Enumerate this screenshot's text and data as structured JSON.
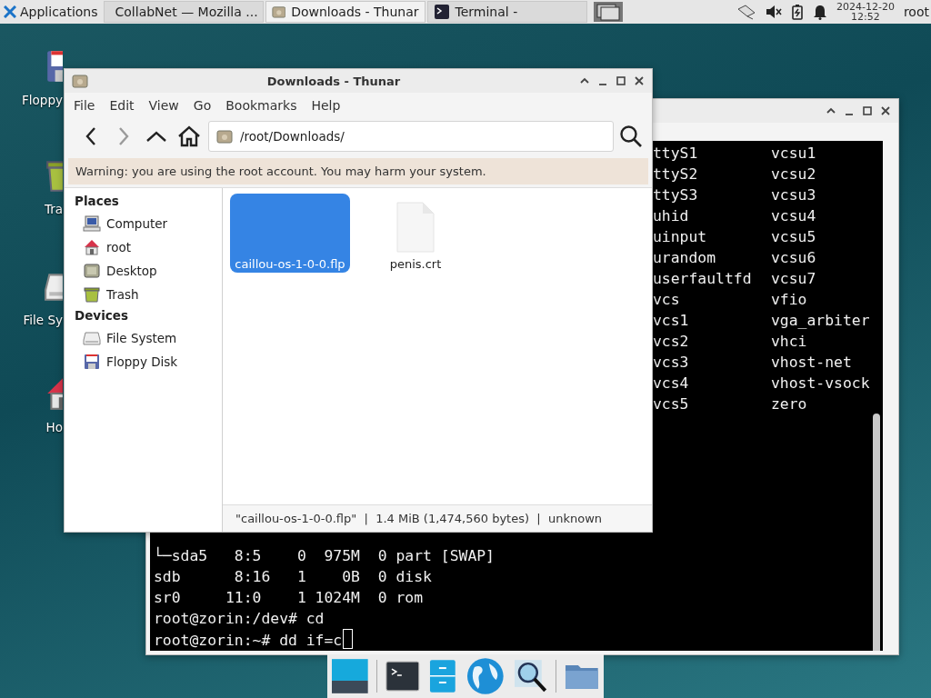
{
  "panel": {
    "app_menu": "Applications",
    "tasks": [
      {
        "label": "CollabNet — Mozilla ...",
        "kind": "browser",
        "selected": false
      },
      {
        "label": "Downloads - Thunar",
        "kind": "folder",
        "selected": true
      },
      {
        "label": "Terminal -",
        "kind": "terminal",
        "selected": false
      }
    ],
    "clock": {
      "date": "2024-12-20",
      "time": "12:52"
    },
    "user": "root"
  },
  "desktop_icons": [
    {
      "label": "Floppy",
      "kind": "floppy"
    },
    {
      "label": "Tra",
      "kind": "trash"
    },
    {
      "label": "File Sy",
      "kind": "drive"
    },
    {
      "label": "Ho",
      "kind": "home"
    }
  ],
  "terminal": {
    "listing": [
      [
        "ttyS1",
        "vcsu1"
      ],
      [
        "ttyS2",
        "vcsu2"
      ],
      [
        "ttyS3",
        "vcsu3"
      ],
      [
        "uhid",
        "vcsu4"
      ],
      [
        "uinput",
        "vcsu5"
      ],
      [
        "urandom",
        "vcsu6"
      ],
      [
        "userfaultfd",
        "vcsu7"
      ],
      [
        "vcs",
        "vfio"
      ],
      [
        "vcs1",
        "vga_arbiter"
      ],
      [
        "vcs2",
        "vhci"
      ],
      [
        "vcs3",
        "vhost-net"
      ],
      [
        "vcs4",
        "vhost-vsock"
      ],
      [
        "vcs5",
        "zero"
      ]
    ],
    "lines": [
      "└─sda5   8:5    0  975M  0 part [SWAP]",
      "sdb      8:16   1    0B  0 disk",
      "sr0     11:0    1 1024M  0 rom",
      "root@zorin:/dev# cd"
    ],
    "prompt": "root@zorin:~# dd if=c"
  },
  "thunar": {
    "title": "Downloads - Thunar",
    "menu": [
      "File",
      "Edit",
      "View",
      "Go",
      "Bookmarks",
      "Help"
    ],
    "toolbar": [
      {
        "kind": "back",
        "disabled": false
      },
      {
        "kind": "forward",
        "disabled": true
      },
      {
        "kind": "up",
        "disabled": false
      },
      {
        "kind": "home",
        "disabled": false
      }
    ],
    "path": "/root/Downloads/",
    "warning": "Warning: you are using the root account. You may harm your system.",
    "sidebar": [
      {
        "heading": "Places",
        "items": [
          {
            "label": "Computer",
            "kind": "computer"
          },
          {
            "label": "root",
            "kind": "home"
          },
          {
            "label": "Desktop",
            "kind": "desktop"
          },
          {
            "label": "Trash",
            "kind": "trash"
          }
        ]
      },
      {
        "heading": "Devices",
        "items": [
          {
            "label": "File System",
            "kind": "drive"
          },
          {
            "label": "Floppy Disk",
            "kind": "floppy"
          }
        ]
      }
    ],
    "files": [
      {
        "name": "caillou-os-1-0-0.flp",
        "kind": "floppy-image",
        "selected": true
      },
      {
        "name": "penis.crt",
        "kind": "document",
        "selected": false
      }
    ],
    "status": "\"caillou-os-1-0-0.flp\"  |  1.4 MiB (1,474,560 bytes)  |  unknown"
  },
  "dock": [
    {
      "kind": "show-desktop"
    },
    {
      "kind": "separator"
    },
    {
      "kind": "terminal"
    },
    {
      "kind": "file-cabinet"
    },
    {
      "kind": "globe"
    },
    {
      "kind": "search"
    },
    {
      "kind": "separator"
    },
    {
      "kind": "folder"
    }
  ]
}
